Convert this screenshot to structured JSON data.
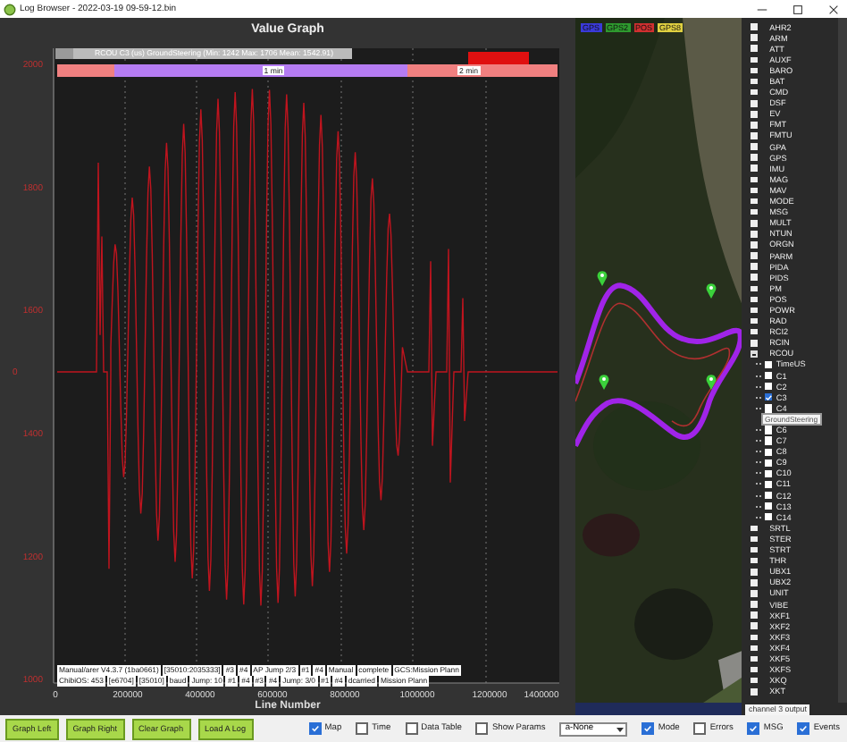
{
  "window": {
    "title": "Log Browser - 2022-03-19 09-59-12.bin"
  },
  "graph": {
    "title": "Value Graph",
    "legend": "RCOU C3 (us) GroundSteering (Min: 1242 Max: 1706 Mean: 1542.91)",
    "y_axis_label": "0",
    "y_ticks": [
      "2000",
      "1800",
      "1600",
      "1400",
      "1200",
      "1000"
    ],
    "x_ticks": [
      "0",
      "200000",
      "400000",
      "600000",
      "800000",
      "1000000",
      "1200000",
      "1400000"
    ],
    "x_label": "Line Number",
    "modes": [
      {
        "color": "#f08080"
      },
      {
        "color": "#b57cf2"
      },
      {
        "color": "#f08080"
      }
    ],
    "time_marks": [
      "1 min",
      "2 min"
    ],
    "messages": [
      [
        "Manual/arer V4.3.7 (1ba0661)",
        "[35010:2035333]",
        "#3",
        "#4",
        "AP Jump 2/3",
        "#1",
        "#4",
        "Manual",
        "complete",
        "GCS:Mission Plann"
      ],
      [
        "ChibiOS: 453",
        "[e6704]",
        "[35010]",
        "baud",
        "Jump: 10",
        "#1",
        "#4",
        "#3",
        "#4",
        "Jump: 3/0",
        "#1",
        "#4",
        "dcarried",
        "Mission Plann"
      ]
    ]
  },
  "map": {
    "legend": [
      {
        "label": "GPS",
        "color": "#3a3ad8"
      },
      {
        "label": "GPS2",
        "color": "#2e9a2e"
      },
      {
        "label": "POS",
        "color": "#d03030"
      },
      {
        "label": "GPS8",
        "color": "#e0d040"
      }
    ]
  },
  "tree": {
    "items": [
      {
        "label": "AHR2",
        "expanded": false
      },
      {
        "label": "ARM",
        "expanded": false
      },
      {
        "label": "ATT",
        "expanded": false
      },
      {
        "label": "AUXF",
        "expanded": false
      },
      {
        "label": "BARO",
        "expanded": false
      },
      {
        "label": "BAT",
        "expanded": false
      },
      {
        "label": "CMD",
        "expanded": false
      },
      {
        "label": "DSF",
        "expanded": false
      },
      {
        "label": "EV",
        "expanded": false
      },
      {
        "label": "FMT",
        "expanded": false
      },
      {
        "label": "FMTU",
        "expanded": false
      },
      {
        "label": "GPA",
        "expanded": false
      },
      {
        "label": "GPS",
        "expanded": false
      },
      {
        "label": "IMU",
        "expanded": false
      },
      {
        "label": "MAG",
        "expanded": false
      },
      {
        "label": "MAV",
        "expanded": false
      },
      {
        "label": "MODE",
        "expanded": false
      },
      {
        "label": "MSG",
        "expanded": false
      },
      {
        "label": "MULT",
        "expanded": false
      },
      {
        "label": "NTUN",
        "expanded": false
      },
      {
        "label": "ORGN",
        "expanded": false
      },
      {
        "label": "PARM",
        "expanded": false
      },
      {
        "label": "PIDA",
        "expanded": false
      },
      {
        "label": "PIDS",
        "expanded": false
      },
      {
        "label": "PM",
        "expanded": false
      },
      {
        "label": "POS",
        "expanded": false
      },
      {
        "label": "POWR",
        "expanded": false
      },
      {
        "label": "RAD",
        "expanded": false
      },
      {
        "label": "RCI2",
        "expanded": false
      },
      {
        "label": "RCIN",
        "expanded": false
      },
      {
        "label": "RCOU",
        "expanded": true,
        "children": [
          {
            "kind": "field",
            "label": "TimeUS",
            "checked": false
          },
          {
            "kind": "field",
            "label": "C1",
            "checked": false
          },
          {
            "kind": "field",
            "label": "C2",
            "checked": false
          },
          {
            "kind": "field",
            "label": "C3",
            "checked": true
          },
          {
            "kind": "field",
            "label": "C4",
            "checked": false
          },
          {
            "kind": "tooltip",
            "label": "GroundSteering"
          },
          {
            "kind": "field",
            "label": "C6",
            "checked": false
          },
          {
            "kind": "field",
            "label": "C7",
            "checked": false
          },
          {
            "kind": "field",
            "label": "C8",
            "checked": false
          },
          {
            "kind": "field",
            "label": "C9",
            "checked": false
          },
          {
            "kind": "field",
            "label": "C10",
            "checked": false
          },
          {
            "kind": "field",
            "label": "C11",
            "checked": false
          },
          {
            "kind": "field",
            "label": "C12",
            "checked": false
          },
          {
            "kind": "field",
            "label": "C13",
            "checked": false
          },
          {
            "kind": "field",
            "label": "C14",
            "checked": false
          }
        ]
      },
      {
        "label": "SRTL",
        "expanded": false
      },
      {
        "label": "STER",
        "expanded": false
      },
      {
        "label": "STRT",
        "expanded": false
      },
      {
        "label": "THR",
        "expanded": false
      },
      {
        "label": "UBX1",
        "expanded": false
      },
      {
        "label": "UBX2",
        "expanded": false
      },
      {
        "label": "UNIT",
        "expanded": false
      },
      {
        "label": "VIBE",
        "expanded": false
      },
      {
        "label": "XKF1",
        "expanded": false
      },
      {
        "label": "XKF2",
        "expanded": false
      },
      {
        "label": "XKF3",
        "expanded": false
      },
      {
        "label": "XKF4",
        "expanded": false
      },
      {
        "label": "XKF5",
        "expanded": false
      },
      {
        "label": "XKFS",
        "expanded": false
      },
      {
        "label": "XKQ",
        "expanded": false
      },
      {
        "label": "XKT",
        "expanded": false
      }
    ],
    "tooltip": "channel 3 output"
  },
  "toolbar": {
    "buttons": [
      "Graph Left",
      "Graph Right",
      "Clear Graph",
      "Load A Log"
    ],
    "controls": [
      {
        "kind": "checkbox",
        "label": "Map",
        "checked": true
      },
      {
        "kind": "checkbox",
        "label": "Time",
        "checked": false
      },
      {
        "kind": "checkbox",
        "label": "Data Table",
        "checked": false
      },
      {
        "kind": "checkbox",
        "label": "Show Params",
        "checked": false
      },
      {
        "kind": "dropdown",
        "value": "a-None"
      },
      {
        "kind": "checkbox",
        "label": "Mode",
        "checked": true
      },
      {
        "kind": "checkbox",
        "label": "Errors",
        "checked": false
      },
      {
        "kind": "checkbox",
        "label": "MSG",
        "checked": true
      },
      {
        "kind": "checkbox",
        "label": "Events",
        "checked": true
      }
    ]
  }
}
